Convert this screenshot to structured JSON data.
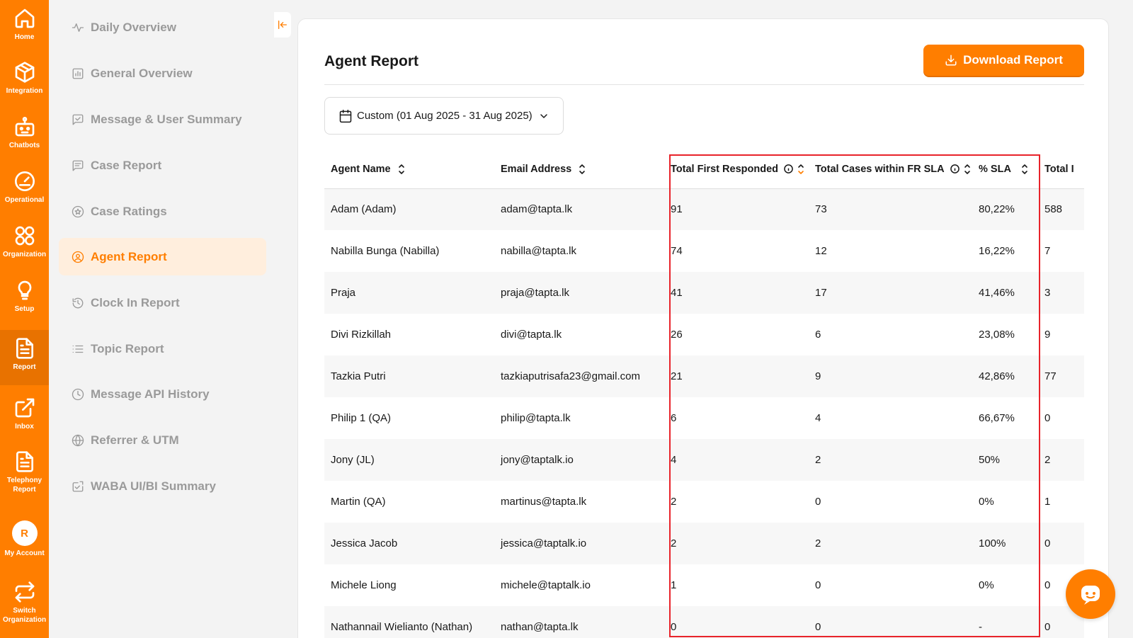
{
  "rail": {
    "items": [
      {
        "label": "Home",
        "icon": "home-icon"
      },
      {
        "label": "Integration",
        "icon": "cube-icon"
      },
      {
        "label": "Chatbots",
        "icon": "robot-icon"
      },
      {
        "label": "Operational",
        "icon": "gauge-icon"
      },
      {
        "label": "Organization",
        "icon": "grid-circles-icon"
      },
      {
        "label": "Setup",
        "icon": "lightbulb-icon"
      },
      {
        "label": "Report",
        "icon": "document-icon"
      },
      {
        "label": "Inbox",
        "icon": "external-link-icon"
      },
      {
        "label": "Telephony Report",
        "icon": "document-icon"
      },
      {
        "label": "My Account",
        "avatar_letter": "R"
      },
      {
        "label": "Switch Organization",
        "icon": "switch-icon"
      }
    ]
  },
  "subnav": {
    "items": [
      {
        "label": "Daily Overview",
        "icon": "activity-icon"
      },
      {
        "label": "General Overview",
        "icon": "bar-chart-icon"
      },
      {
        "label": "Message & User Summary",
        "icon": "message-check-icon"
      },
      {
        "label": "Case Report",
        "icon": "message-lines-icon"
      },
      {
        "label": "Case Ratings",
        "icon": "star-circle-icon"
      },
      {
        "label": "Agent Report",
        "icon": "user-circle-icon"
      },
      {
        "label": "Clock In Report",
        "icon": "clock-rotate-icon"
      },
      {
        "label": "Topic Report",
        "icon": "list-icon"
      },
      {
        "label": "Message API History",
        "icon": "clock-icon"
      },
      {
        "label": "Referrer & UTM",
        "icon": "globe-icon"
      },
      {
        "label": "WABA UI/BI Summary",
        "icon": "message-arrow-icon"
      }
    ]
  },
  "report": {
    "title": "Agent Report",
    "download_label": "Download Report",
    "date_filter": "Custom (01 Aug 2025 - 31 Aug 2025)"
  },
  "table": {
    "columns": [
      "Agent Name",
      "Email Address",
      "Total First Responded",
      "Total Cases within FR SLA",
      "% SLA",
      "Total I"
    ],
    "rows": [
      [
        "Adam (Adam)",
        "adam@tapta.lk",
        "91",
        "73",
        "80,22%",
        "588"
      ],
      [
        "Nabilla Bunga (Nabilla)",
        "nabilla@tapta.lk",
        "74",
        "12",
        "16,22%",
        "7"
      ],
      [
        "Praja",
        "praja@tapta.lk",
        "41",
        "17",
        "41,46%",
        "3"
      ],
      [
        "Divi Rizkillah",
        "divi@tapta.lk",
        "26",
        "6",
        "23,08%",
        "9"
      ],
      [
        "Tazkia Putri",
        "tazkiaputrisafa23@gmail.com",
        "21",
        "9",
        "42,86%",
        "77"
      ],
      [
        "Philip 1 (QA)",
        "philip@tapta.lk",
        "6",
        "4",
        "66,67%",
        "0"
      ],
      [
        "Jony (JL)",
        "jony@taptalk.io",
        "4",
        "2",
        "50%",
        "2"
      ],
      [
        "Martin (QA)",
        "martinus@tapta.lk",
        "2",
        "0",
        "0%",
        "1"
      ],
      [
        "Jessica Jacob",
        "jessica@taptalk.io",
        "2",
        "2",
        "100%",
        "0"
      ],
      [
        "Michele Liong",
        "michele@taptalk.io",
        "1",
        "0",
        "0%",
        "0"
      ],
      [
        "Nathannail Wielianto (Nathan)",
        "nathan@tapta.lk",
        "0",
        "0",
        "-",
        "0"
      ]
    ]
  },
  "colors": {
    "brand": "#ff7e00",
    "highlight": "#e8232a"
  }
}
